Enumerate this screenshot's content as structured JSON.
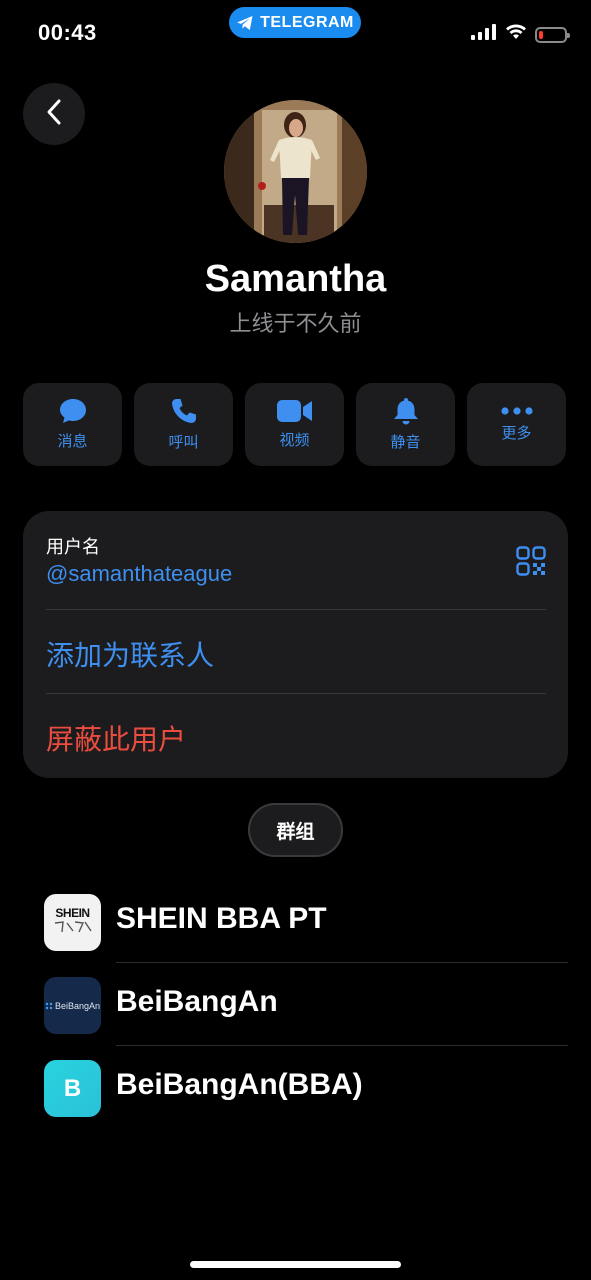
{
  "status_bar": {
    "time": "00:43",
    "app_pill": "TELEGRAM",
    "battery_level": 0.15
  },
  "profile": {
    "name": "Samantha",
    "status": "上线于不久前"
  },
  "actions": [
    {
      "label": "消息",
      "icon": "message-icon"
    },
    {
      "label": "呼叫",
      "icon": "phone-icon"
    },
    {
      "label": "视频",
      "icon": "video-icon"
    },
    {
      "label": "静音",
      "icon": "bell-icon"
    },
    {
      "label": "更多",
      "icon": "more-icon"
    }
  ],
  "info": {
    "username_label": "用户名",
    "username_value": "@samanthateague",
    "add_contact": "添加为联系人",
    "block_user": "屏蔽此用户"
  },
  "groups_tab": "群组",
  "groups": [
    {
      "name": "SHEIN BBA PT",
      "icon_text": "SHEIN"
    },
    {
      "name": "BeiBangAn",
      "icon_text": "BeiBangAn"
    },
    {
      "name": "BeiBangAn(BBA)",
      "icon_text": "B"
    }
  ],
  "colors": {
    "accent": "#3e8ff0",
    "destructive": "#ea4d3f",
    "telegram_pill": "#1a8cf0",
    "card": "#1c1c1e"
  }
}
